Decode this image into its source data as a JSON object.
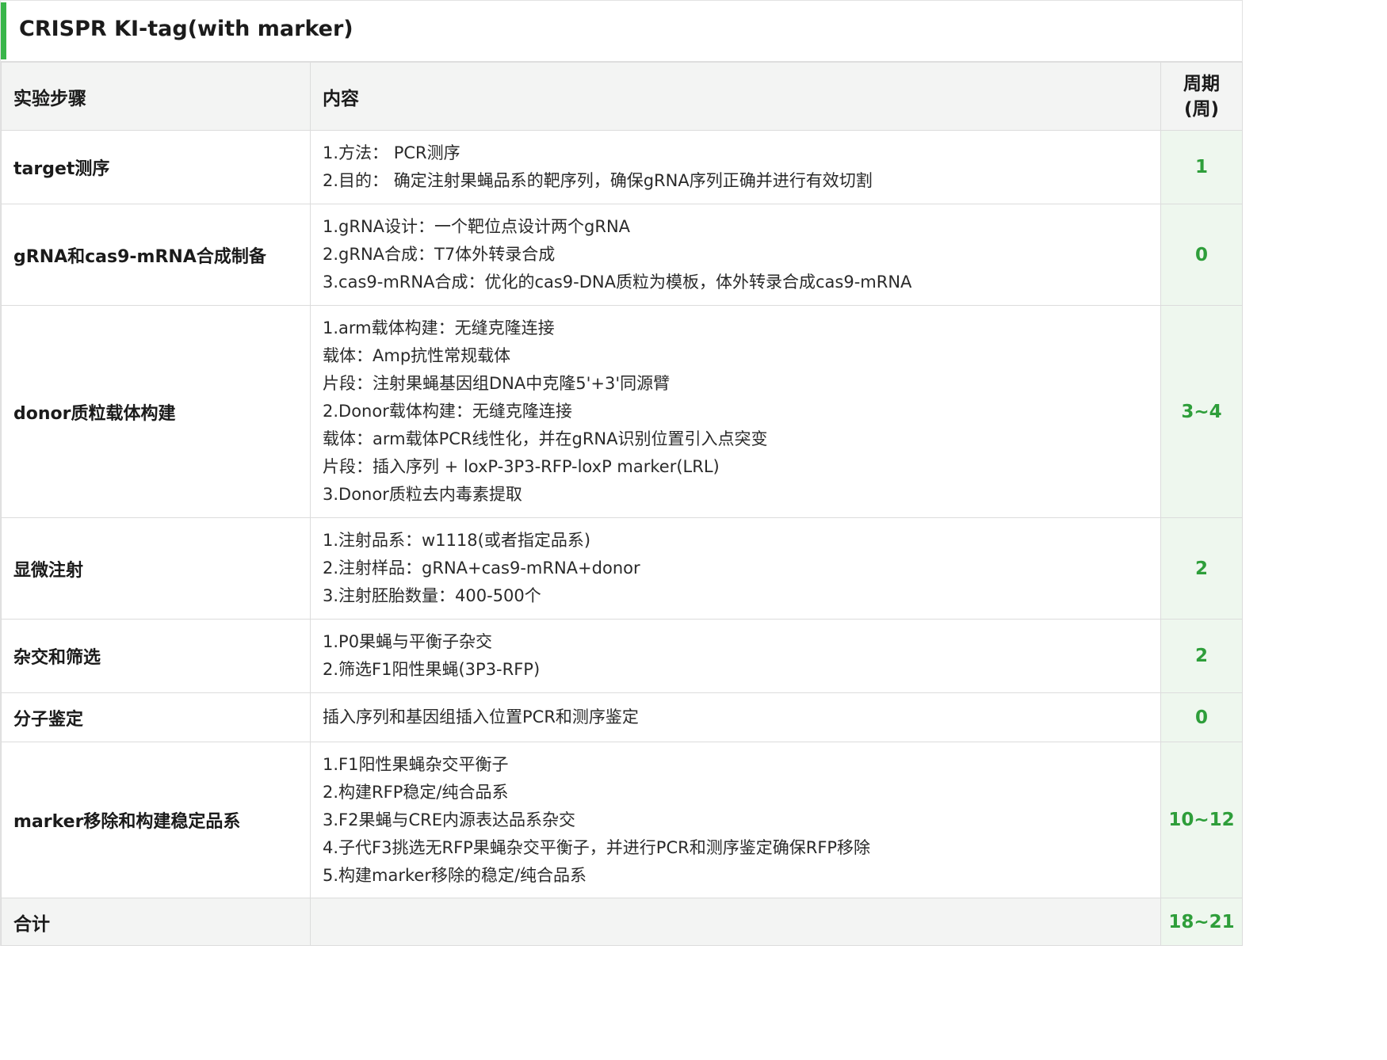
{
  "title": "CRISPR KI-tag(with marker)",
  "accent_color": "#39b54a",
  "period_color": "#2e9e3a",
  "headers": {
    "step": "实验步骤",
    "content": "内容",
    "period_line1": "周期",
    "period_line2": "(周)"
  },
  "rows": [
    {
      "step": "target测序",
      "lines": [
        "1.方法： PCR测序",
        "2.目的： 确定注射果蝇品系的靶序列，确保gRNA序列正确并进行有效切割"
      ],
      "period": "1"
    },
    {
      "step": "gRNA和cas9-mRNA合成制备",
      "lines": [
        "1.gRNA设计：一个靶位点设计两个gRNA",
        "2.gRNA合成：T7体外转录合成",
        "3.cas9-mRNA合成：优化的cas9-DNA质粒为模板，体外转录合成cas9-mRNA"
      ],
      "period": "0"
    },
    {
      "step": "donor质粒载体构建",
      "lines": [
        "1.arm载体构建：无缝克隆连接",
        "载体：Amp抗性常规载体",
        "片段：注射果蝇基因组DNA中克隆5'+3'同源臂",
        "2.Donor载体构建：无缝克隆连接",
        "载体：arm载体PCR线性化，并在gRNA识别位置引入点突变",
        "片段：插入序列 + loxP-3P3-RFP-loxP marker(LRL)",
        "3.Donor质粒去内毒素提取"
      ],
      "period": "3~4"
    },
    {
      "step": "显微注射",
      "lines": [
        "1.注射品系：w1118(或者指定品系)",
        "2.注射样品：gRNA+cas9-mRNA+donor",
        "3.注射胚胎数量：400-500个"
      ],
      "period": "2"
    },
    {
      "step": "杂交和筛选",
      "lines": [
        "1.P0果蝇与平衡子杂交",
        "2.筛选F1阳性果蝇(3P3-RFP)"
      ],
      "period": "2"
    },
    {
      "step": "分子鉴定",
      "lines": [
        "插入序列和基因组插入位置PCR和测序鉴定"
      ],
      "period": "0"
    },
    {
      "step": "marker移除和构建稳定品系",
      "lines": [
        "1.F1阳性果蝇杂交平衡子",
        "2.构建RFP稳定/纯合品系",
        "3.F2果蝇与CRE内源表达品系杂交",
        "4.子代F3挑选无RFP果蝇杂交平衡子，并进行PCR和测序鉴定确保RFP移除",
        "5.构建marker移除的稳定/纯合品系"
      ],
      "period": "10~12"
    }
  ],
  "total": {
    "label": "合计",
    "period": "18~21"
  }
}
